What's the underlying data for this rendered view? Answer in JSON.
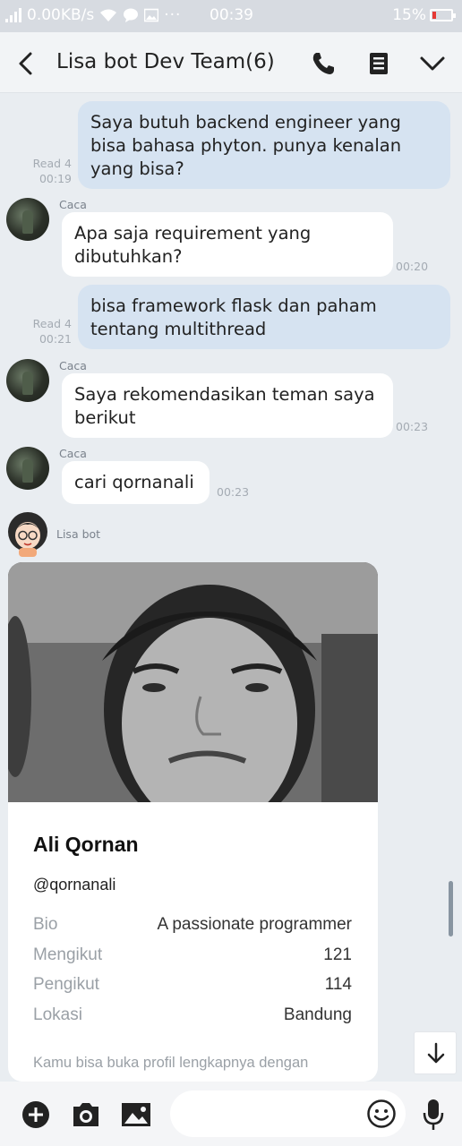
{
  "status_bar": {
    "network_speed": "0.00KB/s",
    "time": "00:39",
    "battery": "15%"
  },
  "header": {
    "title": "Lisa bot Dev Team(6)"
  },
  "messages": [
    {
      "lines": [
        "Saya butuh backend engineer yang",
        "bisa bahasa phyton. punya kenalan",
        "yang bisa?"
      ],
      "read": "Read 4",
      "time": "00:19"
    },
    {
      "sender": "Caca",
      "lines": [
        "Apa saja requirement yang",
        "dibutuhkan?"
      ],
      "time": "00:20"
    },
    {
      "lines": [
        "bisa framework flask dan paham",
        "tentang multithread"
      ],
      "read": "Read 4",
      "time": "00:21"
    },
    {
      "sender": "Caca",
      "lines": [
        "Saya rekomendasikan teman saya",
        "berikut"
      ],
      "time": "00:23"
    },
    {
      "sender": "Caca",
      "lines": [
        "cari qornanali"
      ],
      "time": "00:23"
    },
    {
      "sender": "Lisa bot"
    }
  ],
  "profile_card": {
    "name": "Ali Qornan",
    "handle": "@qornanali",
    "rows": [
      {
        "key": "Bio",
        "value": "A passionate programmer"
      },
      {
        "key": "Mengikut",
        "value": "121"
      },
      {
        "key": "Pengikut",
        "value": "114"
      },
      {
        "key": "Lokasi",
        "value": "Bandung"
      }
    ],
    "note": "Kamu bisa buka profil lengkapnya dengan"
  },
  "input": {
    "value": "",
    "placeholder": ""
  },
  "colors": {
    "my_bubble": "#d6e3f1",
    "their_bubble": "#ffffff",
    "background": "#e9edf1",
    "battery_low": "#e53935"
  }
}
